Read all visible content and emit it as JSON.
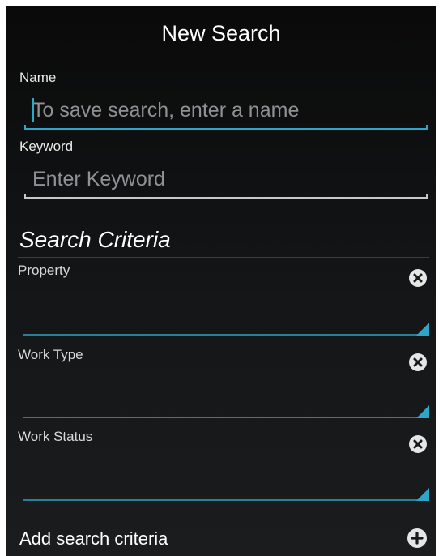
{
  "header": {
    "title": "New Search"
  },
  "form": {
    "name": {
      "label": "Name",
      "placeholder": "To save search, enter a name",
      "value": ""
    },
    "keyword": {
      "label": "Keyword",
      "placeholder": "Enter Keyword",
      "value": ""
    }
  },
  "criteria": {
    "header": "Search Criteria",
    "items": [
      {
        "label": "Property",
        "value": "",
        "remove_icon": "remove-circle-icon",
        "dropdown_icon": "spinner-arrow-icon"
      },
      {
        "label": "Work Type",
        "value": "",
        "remove_icon": "remove-circle-icon",
        "dropdown_icon": "spinner-arrow-icon"
      },
      {
        "label": "Work Status",
        "value": "",
        "remove_icon": "remove-circle-icon",
        "dropdown_icon": "spinner-arrow-icon"
      }
    ],
    "add_label": "Add search criteria",
    "add_icon": "add-circle-icon"
  },
  "colors": {
    "accent": "#2ea6c7",
    "background": "#111315",
    "text": "#f2f2f2",
    "placeholder": "#8f9194"
  }
}
